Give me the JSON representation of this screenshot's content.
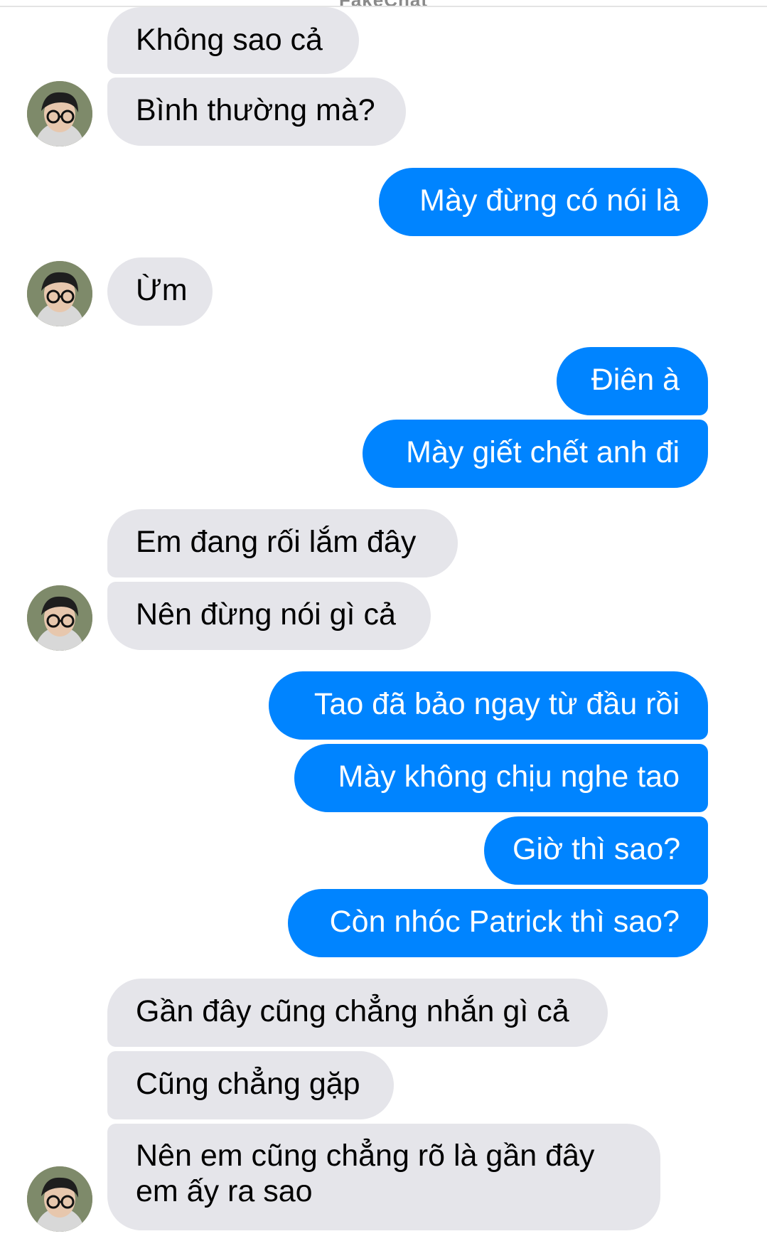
{
  "watermark": "FakeChat",
  "colors": {
    "incoming_bubble": "#e5e5ea",
    "outgoing_bubble": "#0084ff",
    "outgoing_text": "#ffffff",
    "incoming_text": "#000000"
  },
  "avatar_icon": "user-avatar-photo",
  "messages": [
    {
      "side": "incoming",
      "text": "Không sao cả"
    },
    {
      "side": "incoming",
      "text": "Bình thường mà?"
    },
    {
      "side": "outgoing",
      "text": "Mày đừng có nói là"
    },
    {
      "side": "incoming",
      "text": "Ừm"
    },
    {
      "side": "outgoing",
      "text": "Điên à"
    },
    {
      "side": "outgoing",
      "text": "Mày giết chết anh đi"
    },
    {
      "side": "incoming",
      "text": "Em đang rối lắm đây"
    },
    {
      "side": "incoming",
      "text": "Nên đừng nói gì cả"
    },
    {
      "side": "outgoing",
      "text": "Tao đã bảo ngay từ đầu rồi"
    },
    {
      "side": "outgoing",
      "text": "Mày không chịu nghe tao"
    },
    {
      "side": "outgoing",
      "text": "Giờ thì sao?"
    },
    {
      "side": "outgoing",
      "text": "Còn nhóc Patrick thì sao?"
    },
    {
      "side": "incoming",
      "text": "Gần đây cũng chẳng nhắn gì cả"
    },
    {
      "side": "incoming",
      "text": "Cũng chẳng gặp"
    },
    {
      "side": "incoming",
      "text": "Nên em cũng chẳng rõ là gần đây em ấy ra sao"
    }
  ]
}
